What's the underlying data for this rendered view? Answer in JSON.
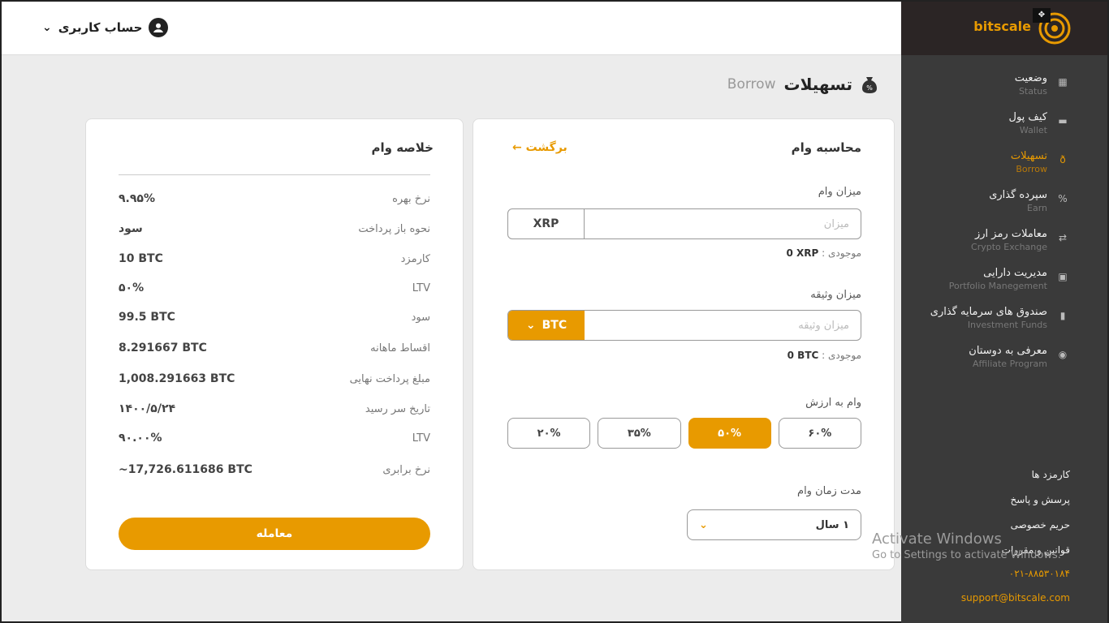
{
  "topbar": {
    "account_label": "حساب کاربری"
  },
  "brand": {
    "name": "bitscale"
  },
  "sidebar": {
    "items": [
      {
        "fa": "وضعیت",
        "en": "Status",
        "icon": "dashboard-icon"
      },
      {
        "fa": "کیف پول",
        "en": "Wallet",
        "icon": "wallet-icon"
      },
      {
        "fa": "تسهیلات",
        "en": "Borrow",
        "icon": "money-bag-icon",
        "active": true
      },
      {
        "fa": "سپرده گذاری",
        "en": "Earn",
        "icon": "percent-icon"
      },
      {
        "fa": "معاملات رمز ارز",
        "en": "Crypto Exchange",
        "icon": "exchange-icon"
      },
      {
        "fa": "مدیریت دارایی",
        "en": "Portfolio Manegement",
        "icon": "briefcase-icon"
      },
      {
        "fa": "صندوق های سرمایه گذاری",
        "en": "Investment Funds",
        "icon": "bar-chart-icon"
      },
      {
        "fa": "معرفی به دوستان",
        "en": "Affiliate Program",
        "icon": "user-circle-icon"
      }
    ],
    "links": [
      "کارمزد ها",
      "پرسش و پاسخ",
      "حریم خصوصی",
      "قوانین و مقررات"
    ],
    "phone": "۰۲۱-۸۸۵۳۰۱۸۴",
    "email": "support@bitscale.com"
  },
  "page": {
    "title_fa": "تسهیلات",
    "title_en": "Borrow"
  },
  "calc": {
    "title": "محاسبه وام",
    "back": "برگشت",
    "loan_label": "میزان وام",
    "loan_placeholder": "میزان",
    "loan_currency": "XRP",
    "loan_balance_label": "موجودی :",
    "loan_balance_value": "0 XRP",
    "collateral_label": "میزان وثیقه",
    "collateral_placeholder": "میزان وثیقه",
    "collateral_currency": "BTC",
    "collateral_balance_label": "موجودی :",
    "collateral_balance_value": "0 BTC",
    "ltv_label": "وام به ارزش",
    "ltv_options": [
      "۶۰%",
      "۵۰%",
      "۳۵%",
      "۲۰%"
    ],
    "ltv_selected_index": 1,
    "duration_label": "مدت زمان وام",
    "duration_value": "۱ سال"
  },
  "summary": {
    "title": "خلاصه وام",
    "rows": [
      {
        "k": "نرخ بهره",
        "v": "۹.۹۵%"
      },
      {
        "k": "نحوه باز پرداخت",
        "v": "سود"
      },
      {
        "k": "کارمزد",
        "v": "10 BTC"
      },
      {
        "k": "LTV",
        "v": "۵۰%"
      },
      {
        "k": "سود",
        "v": "99.5 BTC"
      },
      {
        "k": "اقساط ماهانه",
        "v": "8.291667 BTC"
      },
      {
        "k": "مبلغ پرداخت نهایی",
        "v": "1,008.291663 BTC"
      },
      {
        "k": "تاریخ سر رسید",
        "v": "۱۴۰۰/۵/۲۴"
      },
      {
        "k": "LTV",
        "v": "۹۰.۰۰%"
      },
      {
        "k": "نرخ برابری",
        "v": "~17,726.611686 BTC"
      }
    ],
    "trade_button": "معامله"
  },
  "watermark": {
    "line1": "Activate Windows",
    "line2": "Go to Settings to activate Windows."
  },
  "colors": {
    "accent": "#e89a00",
    "sidebar_bg": "#3a3a3a",
    "brand_bg": "#2b2525"
  }
}
